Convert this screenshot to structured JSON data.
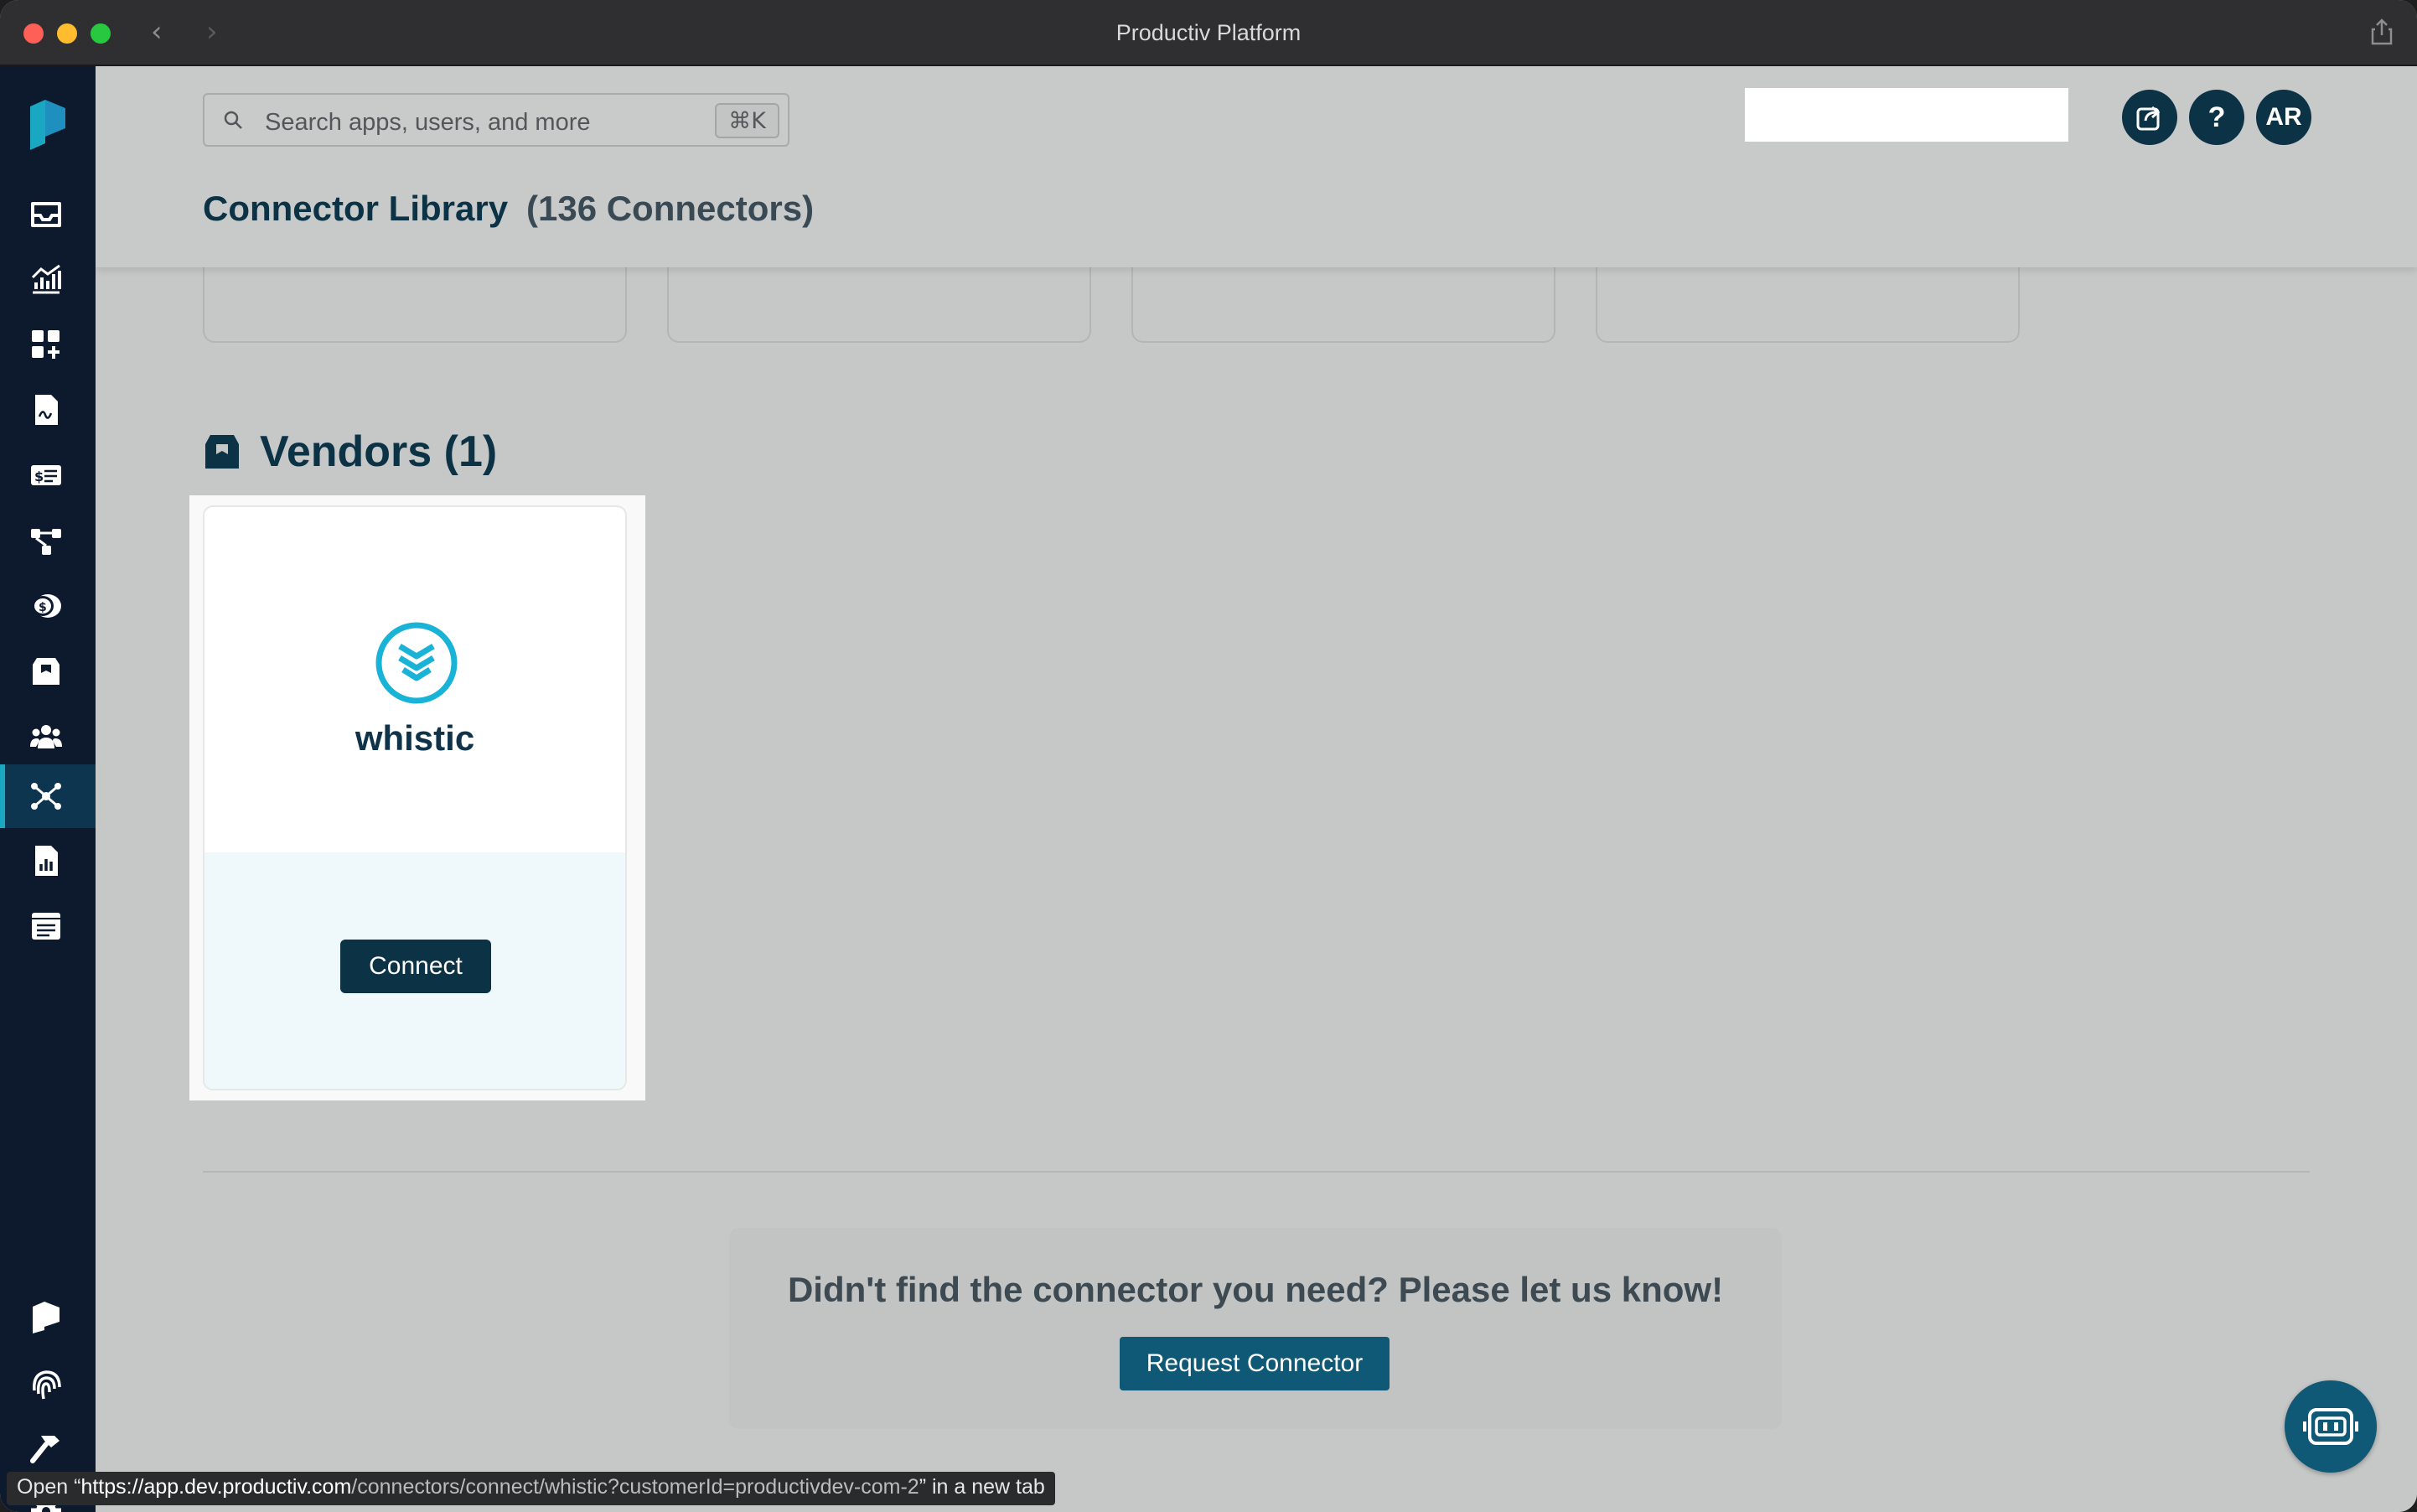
{
  "window": {
    "title": "Productiv Platform"
  },
  "search": {
    "placeholder": "Search apps, users, and more",
    "shortcut": "⌘K"
  },
  "header": {
    "help_label": "?",
    "avatar_initials": "AR"
  },
  "page": {
    "title": "Connector Library",
    "count": "(136 Connectors)"
  },
  "section": {
    "title": "Vendors (1)"
  },
  "card": {
    "name": "whistic",
    "connect_label": "Connect"
  },
  "request": {
    "prompt": "Didn't find the connector you need? Please let us know!",
    "button_label": "Request Connector"
  },
  "status_bar": {
    "prefix": "Open “",
    "host": "https://app.dev.productiv.com",
    "path": "/connectors/connect/whistic?customerId=productivdev-com-2",
    "suffix": "” in a new tab"
  },
  "colors": {
    "brand_navy": "#0c3245",
    "accent_teal": "#1aa7c2",
    "sidebar_bg": "#0d1a2e",
    "button_blue": "#0f5876"
  },
  "sidebar": {
    "items": [
      "inbox-icon",
      "analytics-icon",
      "add-app-icon",
      "contract-icon",
      "license-icon",
      "workflow-icon",
      "spend-icon",
      "vendor-box-icon",
      "users-icon",
      "connectors-icon",
      "report-icon",
      "list-icon",
      "productiv-icon",
      "fingerprint-icon",
      "hammer-icon",
      "gear-icon"
    ],
    "active": "connectors-icon"
  }
}
